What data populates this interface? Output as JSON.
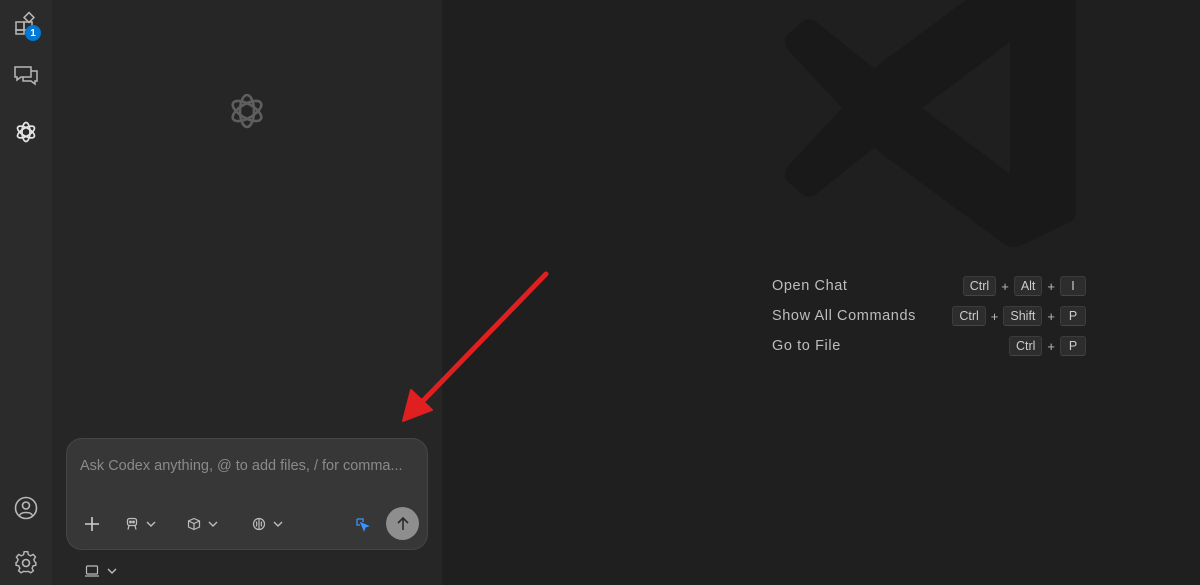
{
  "activity_bar": {
    "explorer": {
      "icon": "explorer-icon",
      "badge": "1"
    },
    "chat": {
      "icon": "chat-icon"
    },
    "codex": {
      "icon": "openai-icon"
    },
    "account": {
      "icon": "account-icon"
    },
    "settings": {
      "icon": "gear-icon"
    }
  },
  "codex_panel": {
    "logo_icon": "openai-icon",
    "input": {
      "value": "",
      "placeholder": "Ask Codex anything, @ to add files, / for comma..."
    },
    "toolbar": {
      "add": {
        "icon": "plus-icon"
      },
      "mode": {
        "icon": "agent-icon",
        "chevron": "chevron-down-icon"
      },
      "model": {
        "icon": "cube-icon",
        "chevron": "chevron-down-icon"
      },
      "reasoning": {
        "icon": "brain-icon",
        "chevron": "chevron-down-icon"
      },
      "context": {
        "icon": "cursor-select-icon",
        "color": "#3794ff"
      },
      "send": {
        "icon": "arrow-up-icon",
        "color": "#8e8e8e"
      }
    },
    "environment": {
      "icon": "laptop-icon",
      "chevron": "chevron-down-icon"
    }
  },
  "editor": {
    "watermark_icon": "vscode-logo-icon",
    "shortcuts": [
      {
        "label": "Open Chat",
        "keys": [
          "Ctrl",
          "Alt",
          "I"
        ]
      },
      {
        "label": "Show All Commands",
        "keys": [
          "Ctrl",
          "Shift",
          "P"
        ]
      },
      {
        "label": "Go to File",
        "keys": [
          "Ctrl",
          "P"
        ]
      }
    ]
  },
  "annotation": {
    "icon": "red-arrow-icon",
    "color": "#e02020"
  },
  "colors": {
    "activity_bar": "#2b2b2b",
    "side_panel": "#262626",
    "editor": "#1f1f1f",
    "badge": "#0078d4"
  }
}
